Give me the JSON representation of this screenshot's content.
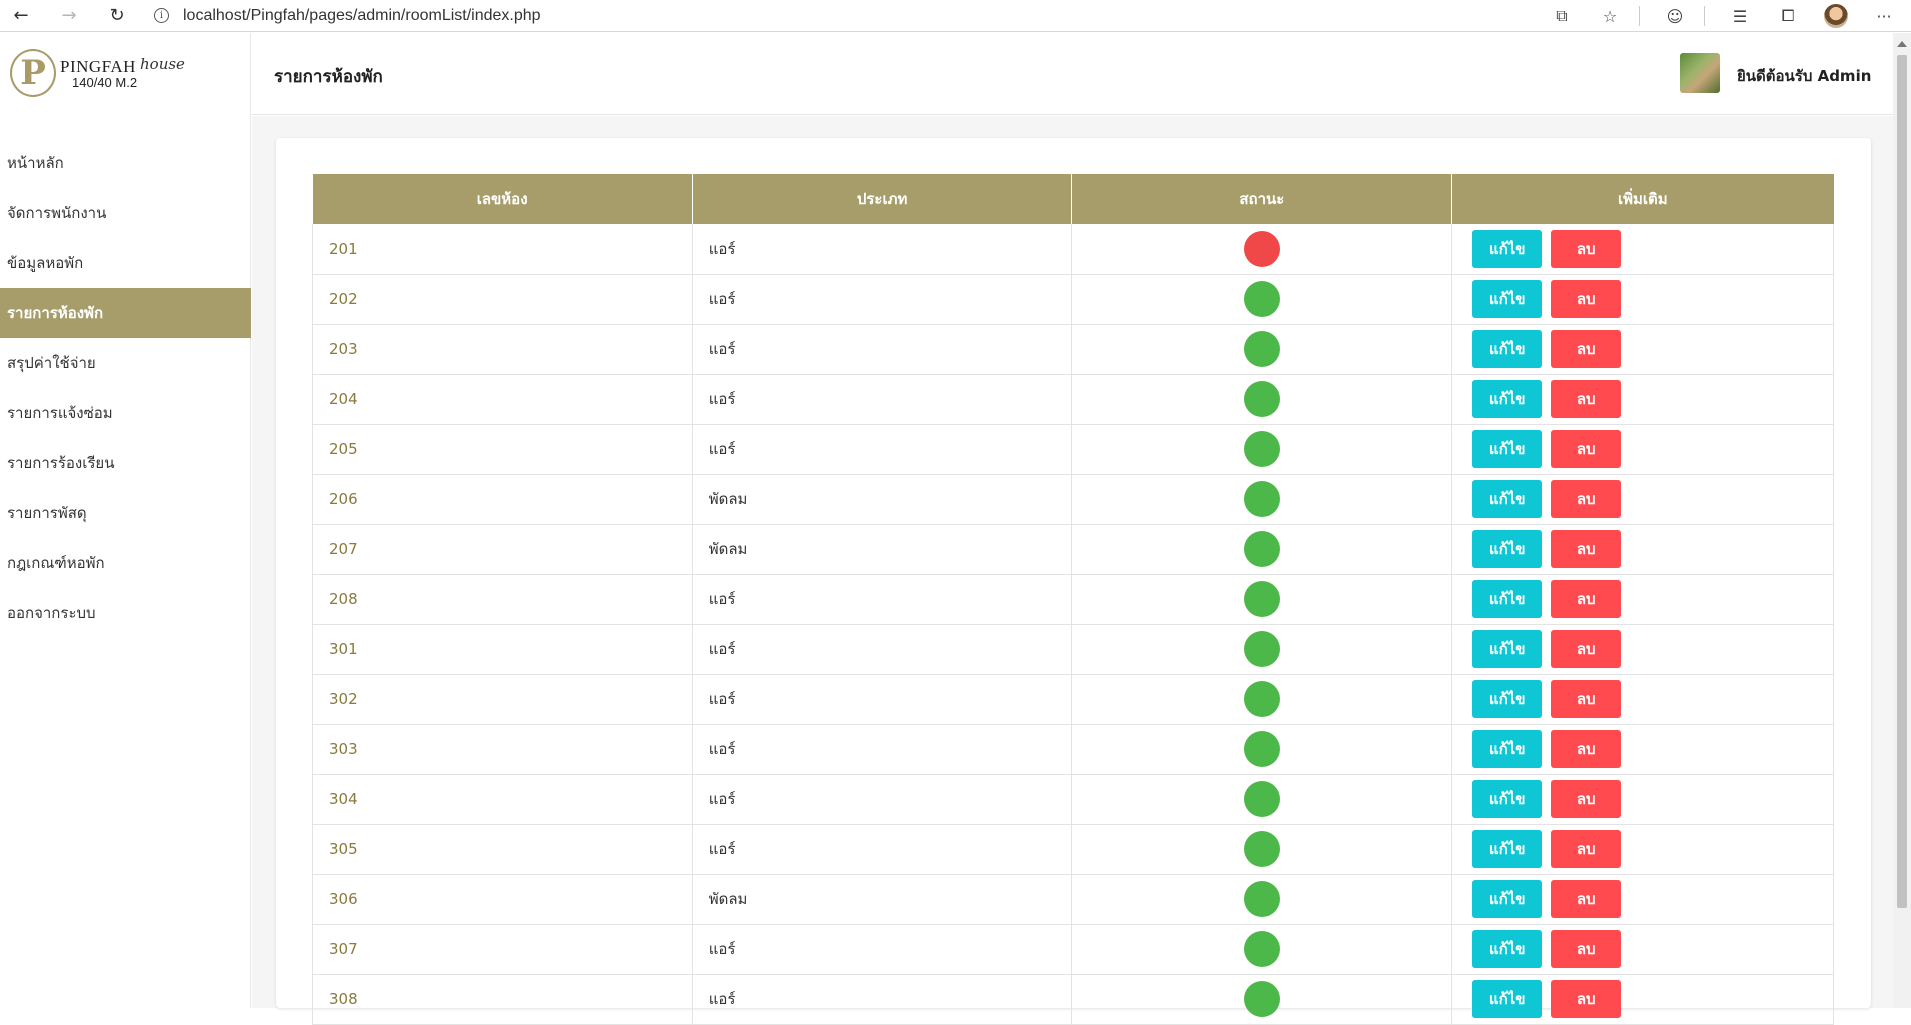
{
  "browser": {
    "url": "localhost/Pingfah/pages/admin/roomList/index.php",
    "back_icon": "←",
    "forward_icon": "→",
    "reload_icon": "↻",
    "info_icon": "i",
    "translate_icon": "⧉",
    "star_icon": "☆",
    "ext_icon": "☺",
    "favorites_icon": "☰",
    "collections_icon": "⧠",
    "more_icon": "···"
  },
  "sidebar": {
    "logo": {
      "mark": "P",
      "name": "PINGFAH",
      "house": "house",
      "address": "140/40 M.2"
    },
    "items": [
      {
        "label": "หน้าหลัก",
        "active": false
      },
      {
        "label": "จัดการพนักงาน",
        "active": false
      },
      {
        "label": "ข้อมูลหอพัก",
        "active": false
      },
      {
        "label": "รายการห้องพัก",
        "active": true
      },
      {
        "label": "สรุปค่าใช้จ่าย",
        "active": false
      },
      {
        "label": "รายการแจ้งซ่อม",
        "active": false
      },
      {
        "label": "รายการร้องเรียน",
        "active": false
      },
      {
        "label": "รายการพัสดุ",
        "active": false
      },
      {
        "label": "กฎเกณฑ์หอพัก",
        "active": false
      },
      {
        "label": "ออกจากระบบ",
        "active": false
      }
    ]
  },
  "header": {
    "title": "รายการห้องพัก",
    "welcome": "ยินดีต้อนรับ Admin"
  },
  "table": {
    "columns": [
      "เลขห้อง",
      "ประเภท",
      "สถานะ",
      "เพิ่มเติม"
    ],
    "edit_label": "แก้ไข",
    "delete_label": "ลบ",
    "status_colors": {
      "occupied": "#f04848",
      "available": "#4cb84a"
    },
    "rows": [
      {
        "room": "201",
        "type": "แอร์",
        "status": "occupied"
      },
      {
        "room": "202",
        "type": "แอร์",
        "status": "available"
      },
      {
        "room": "203",
        "type": "แอร์",
        "status": "available"
      },
      {
        "room": "204",
        "type": "แอร์",
        "status": "available"
      },
      {
        "room": "205",
        "type": "แอร์",
        "status": "available"
      },
      {
        "room": "206",
        "type": "พัดลม",
        "status": "available"
      },
      {
        "room": "207",
        "type": "พัดลม",
        "status": "available"
      },
      {
        "room": "208",
        "type": "แอร์",
        "status": "available"
      },
      {
        "room": "301",
        "type": "แอร์",
        "status": "available"
      },
      {
        "room": "302",
        "type": "แอร์",
        "status": "available"
      },
      {
        "room": "303",
        "type": "แอร์",
        "status": "available"
      },
      {
        "room": "304",
        "type": "แอร์",
        "status": "available"
      },
      {
        "room": "305",
        "type": "แอร์",
        "status": "available"
      },
      {
        "room": "306",
        "type": "พัดลม",
        "status": "available"
      },
      {
        "room": "307",
        "type": "แอร์",
        "status": "available"
      },
      {
        "room": "308",
        "type": "แอร์",
        "status": "available"
      }
    ]
  }
}
